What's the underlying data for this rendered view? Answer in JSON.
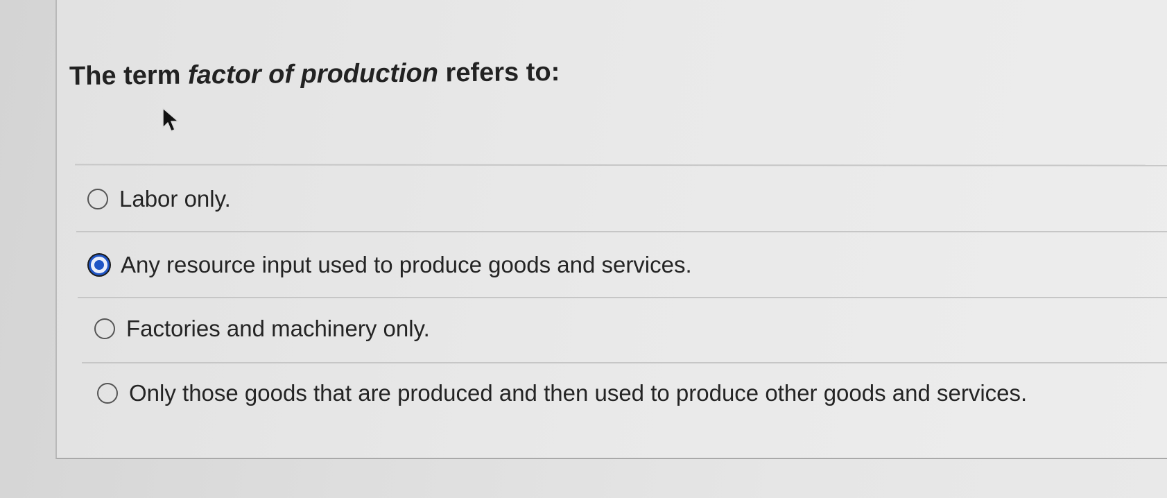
{
  "question": {
    "prefix": "The term ",
    "term": "factor of production",
    "suffix": " refers to:"
  },
  "options": [
    {
      "label": "Labor only.",
      "selected": false
    },
    {
      "label": "Any resource input used to produce goods and services.",
      "selected": true
    },
    {
      "label": "Factories and machinery only.",
      "selected": false
    },
    {
      "label": "Only those goods that are produced and then used to produce other goods and services.",
      "selected": false
    }
  ],
  "colors": {
    "accent": "#1f55c5",
    "background": "#e6e6e6",
    "text": "#242424"
  },
  "icons": {
    "cursor": "mouse-pointer-icon",
    "radio_unselected": "radio-empty-icon",
    "radio_selected": "radio-selected-icon"
  }
}
